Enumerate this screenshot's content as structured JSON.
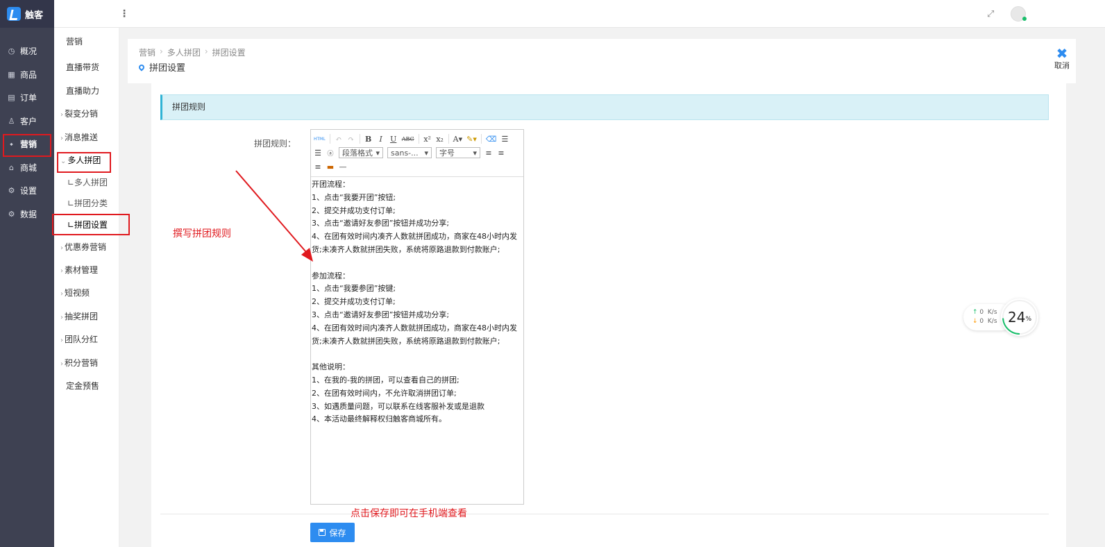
{
  "app": {
    "brand": "触客"
  },
  "sidebar": {
    "items": [
      {
        "label": "概况",
        "icon": "dashboard-icon"
      },
      {
        "label": "商品",
        "icon": "grid-icon"
      },
      {
        "label": "订单",
        "icon": "calendar-icon"
      },
      {
        "label": "客户",
        "icon": "user-icon"
      },
      {
        "label": "营销",
        "icon": "tag-icon",
        "active": true
      },
      {
        "label": "商城",
        "icon": "store-icon"
      },
      {
        "label": "设置",
        "icon": "gear-icon"
      },
      {
        "label": "数据",
        "icon": "gear-icon"
      }
    ]
  },
  "subnav": {
    "items": [
      {
        "label": "营销"
      },
      {
        "label": "直播带货"
      },
      {
        "label": "直播助力"
      },
      {
        "label": "裂变分销",
        "caret": "›"
      },
      {
        "label": "消息推送",
        "caret": "›"
      },
      {
        "label": "多人拼团",
        "caret": "⌄"
      },
      {
        "label": "∟多人拼团"
      },
      {
        "label": "∟拼团分类"
      },
      {
        "label": "∟拼团设置"
      },
      {
        "label": "优惠券营销",
        "caret": "›"
      },
      {
        "label": "素材管理",
        "caret": "›"
      },
      {
        "label": "短视频",
        "caret": "›"
      },
      {
        "label": "抽奖拼团",
        "caret": "›"
      },
      {
        "label": "团队分红",
        "caret": "›"
      },
      {
        "label": "积分营销",
        "caret": "›"
      },
      {
        "label": "定金预售"
      }
    ]
  },
  "breadcrumb": [
    "营销",
    "多人拼团",
    "拼团设置"
  ],
  "page": {
    "title": "拼团设置",
    "cancel_label": "取消"
  },
  "form": {
    "section_title": "拼团规则",
    "label": "拼团规则：",
    "save_label": "保存"
  },
  "editor": {
    "toolbar": {
      "paragraph_select": "段落格式",
      "font_select": "sans-...",
      "size_select": "字号",
      "html_label": "HTML"
    },
    "content": "开团流程：\n1、点击“我要开团”按钮;\n2、提交并成功支付订单;\n3、点击“邀请好友参团”按钮并成功分享;\n4、在团有效时间内凑齐人数就拼团成功，商家在48小时内发货;未凑齐人数就拼团失败，系统将原路退款到付款账户;\n\n参加流程：\n1、点击“我要参团”按键;\n2、提交并成功支付订单;\n3、点击“邀请好友参团”按钮并成功分享;\n4、在团有效时间内凑齐人数就拼团成功，商家在48小时内发货;未凑齐人数就拼团失败，系统将原路退款到付款账户;\n\n其他说明：\n1、在我的-我的拼团，可以查看自己的拼团;\n2、在团有效时间内，不允许取消拼团订单;\n3、如遇质量问题，可以联系在线客服补发或是退款\n4、本活动最终解释权归触客商城所有。"
  },
  "annotations": {
    "write_rules": "撰写拼团规则",
    "save_hint": "点击保存即可在手机端查看"
  },
  "speed_widget": {
    "up": "0",
    "down": "0",
    "unit": "K/s",
    "percent": 24,
    "percent_text": "24",
    "percent_sign": "%"
  },
  "colors": {
    "accent": "#2d8cf0",
    "sidebar": "#3e4152",
    "annotation": "#e0191e",
    "section_bg": "#d9f1f7"
  }
}
